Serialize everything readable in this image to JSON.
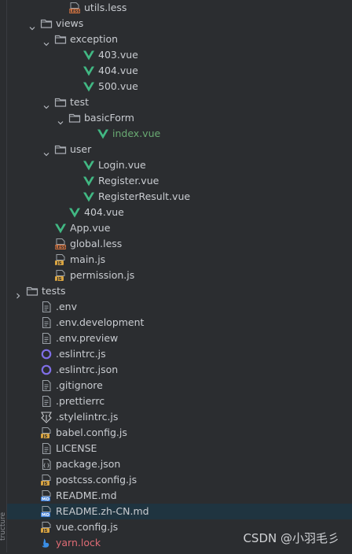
{
  "side_panel": {
    "label": "tructure"
  },
  "tree": [
    {
      "label": "utils.less",
      "icon": "less-file-icon",
      "depth": 4,
      "arrow": "none"
    },
    {
      "label": "views",
      "icon": "folder-icon",
      "depth": 2,
      "arrow": "down"
    },
    {
      "label": "exception",
      "icon": "folder-icon",
      "depth": 3,
      "arrow": "down"
    },
    {
      "label": "403.vue",
      "icon": "vue-file-icon",
      "depth": 5,
      "arrow": "none"
    },
    {
      "label": "404.vue",
      "icon": "vue-file-icon",
      "depth": 5,
      "arrow": "none"
    },
    {
      "label": "500.vue",
      "icon": "vue-file-icon",
      "depth": 5,
      "arrow": "none"
    },
    {
      "label": "test",
      "icon": "folder-icon",
      "depth": 3,
      "arrow": "down"
    },
    {
      "label": "basicForm",
      "icon": "folder-icon",
      "depth": 4,
      "arrow": "down"
    },
    {
      "label": "index.vue",
      "icon": "vue-file-icon",
      "depth": 6,
      "arrow": "none",
      "color": "green"
    },
    {
      "label": "user",
      "icon": "folder-icon",
      "depth": 3,
      "arrow": "down"
    },
    {
      "label": "Login.vue",
      "icon": "vue-file-icon",
      "depth": 5,
      "arrow": "none"
    },
    {
      "label": "Register.vue",
      "icon": "vue-file-icon",
      "depth": 5,
      "arrow": "none"
    },
    {
      "label": "RegisterResult.vue",
      "icon": "vue-file-icon",
      "depth": 5,
      "arrow": "none"
    },
    {
      "label": "404.vue",
      "icon": "vue-file-icon",
      "depth": 4,
      "arrow": "none"
    },
    {
      "label": "App.vue",
      "icon": "vue-file-icon",
      "depth": 3,
      "arrow": "none"
    },
    {
      "label": "global.less",
      "icon": "less-file-icon",
      "depth": 3,
      "arrow": "none"
    },
    {
      "label": "main.js",
      "icon": "js-file-icon",
      "depth": 3,
      "arrow": "none"
    },
    {
      "label": "permission.js",
      "icon": "js-file-icon",
      "depth": 3,
      "arrow": "none"
    },
    {
      "label": "tests",
      "icon": "folder-icon",
      "depth": 1,
      "arrow": "right"
    },
    {
      "label": ".env",
      "icon": "text-file-icon",
      "depth": 2,
      "arrow": "none"
    },
    {
      "label": ".env.development",
      "icon": "text-file-icon",
      "depth": 2,
      "arrow": "none"
    },
    {
      "label": ".env.preview",
      "icon": "text-file-icon",
      "depth": 2,
      "arrow": "none"
    },
    {
      "label": ".eslintrc.js",
      "icon": "eslint-file-icon",
      "depth": 2,
      "arrow": "none"
    },
    {
      "label": ".eslintrc.json",
      "icon": "eslint-file-icon",
      "depth": 2,
      "arrow": "none"
    },
    {
      "label": ".gitignore",
      "icon": "text-file-icon",
      "depth": 2,
      "arrow": "none"
    },
    {
      "label": ".prettierrc",
      "icon": "text-file-icon",
      "depth": 2,
      "arrow": "none"
    },
    {
      "label": ".stylelintrc.js",
      "icon": "stylelint-file-icon",
      "depth": 2,
      "arrow": "none"
    },
    {
      "label": "babel.config.js",
      "icon": "js-file-icon",
      "depth": 2,
      "arrow": "none"
    },
    {
      "label": "LICENSE",
      "icon": "text-file-icon",
      "depth": 2,
      "arrow": "none"
    },
    {
      "label": "package.json",
      "icon": "json-file-icon",
      "depth": 2,
      "arrow": "none"
    },
    {
      "label": "postcss.config.js",
      "icon": "js-file-icon",
      "depth": 2,
      "arrow": "none"
    },
    {
      "label": "README.md",
      "icon": "md-file-icon",
      "depth": 2,
      "arrow": "none"
    },
    {
      "label": "README.zh-CN.md",
      "icon": "md-file-icon",
      "depth": 2,
      "arrow": "none",
      "selected": true
    },
    {
      "label": "vue.config.js",
      "icon": "js-file-icon",
      "depth": 2,
      "arrow": "none"
    },
    {
      "label": "yarn.lock",
      "icon": "yarn-file-icon",
      "depth": 2,
      "arrow": "none",
      "color": "red"
    }
  ],
  "watermark": "CSDN @小羽毛彡",
  "colors": {
    "background": "#2b2d30",
    "selection": "#1f3440",
    "text": "#c9ccd1",
    "vue_green": "#41b883",
    "folder": "#a9adb3",
    "less_orange": "#d27340",
    "js_yellow": "#d9a441",
    "md_blue": "#3b7dd8",
    "eslint_purple": "#7f6ee6",
    "red_text": "#e06c75",
    "green_text": "#6aab73"
  }
}
